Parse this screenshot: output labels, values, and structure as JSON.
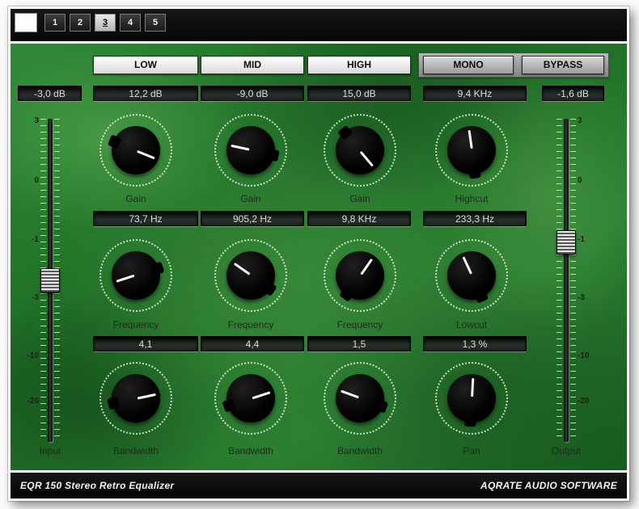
{
  "titlebar": {
    "presets": [
      "1",
      "2",
      "3",
      "4",
      "5"
    ],
    "active_preset": "3"
  },
  "band_buttons": [
    "LOW",
    "MID",
    "HIGH"
  ],
  "mode_buttons": [
    "MONO",
    "BYPASS"
  ],
  "io": {
    "input_label": "Input",
    "input_display": "-3,0 dB",
    "output_label": "Output",
    "output_display": "-1,6 dB",
    "fader_scale": [
      "3",
      "0",
      "-1",
      "-3",
      "-10",
      "-20"
    ]
  },
  "grid": {
    "row1": {
      "displays": [
        "12,2 dB",
        "-9,0 dB",
        "15,0 dB",
        "9,4 KHz"
      ],
      "labels": [
        "Gain",
        "Gain",
        "Gain",
        "Highcut"
      ],
      "angles": [
        112,
        282,
        140,
        352
      ]
    },
    "row2": {
      "displays": [
        "73,7 Hz",
        "905,2 Hz",
        "9,8 KHz",
        "233,3 Hz"
      ],
      "labels": [
        "Frequency",
        "Frequency",
        "Frequency",
        "Lowcut"
      ],
      "angles": [
        252,
        305,
        35,
        335
      ]
    },
    "row3": {
      "displays": [
        "4,1",
        "4,4",
        "1,5",
        "1,3 %"
      ],
      "labels": [
        "Bandwidth",
        "Bandwidth",
        "Bandwidth",
        "Pan"
      ],
      "angles": [
        78,
        72,
        290,
        3
      ]
    }
  },
  "footer": {
    "left": "EQR 150 Stereo Retro Equalizer",
    "right": "AQRATE AUDIO SOFTWARE"
  },
  "colors": {
    "panel_green": "#1d6b24",
    "chrome_black": "#0b0b0b",
    "display_bg": "#141c14",
    "display_text": "#d9ded9",
    "button_light": "#ffffff",
    "button_gray": "#9b9b9b"
  }
}
